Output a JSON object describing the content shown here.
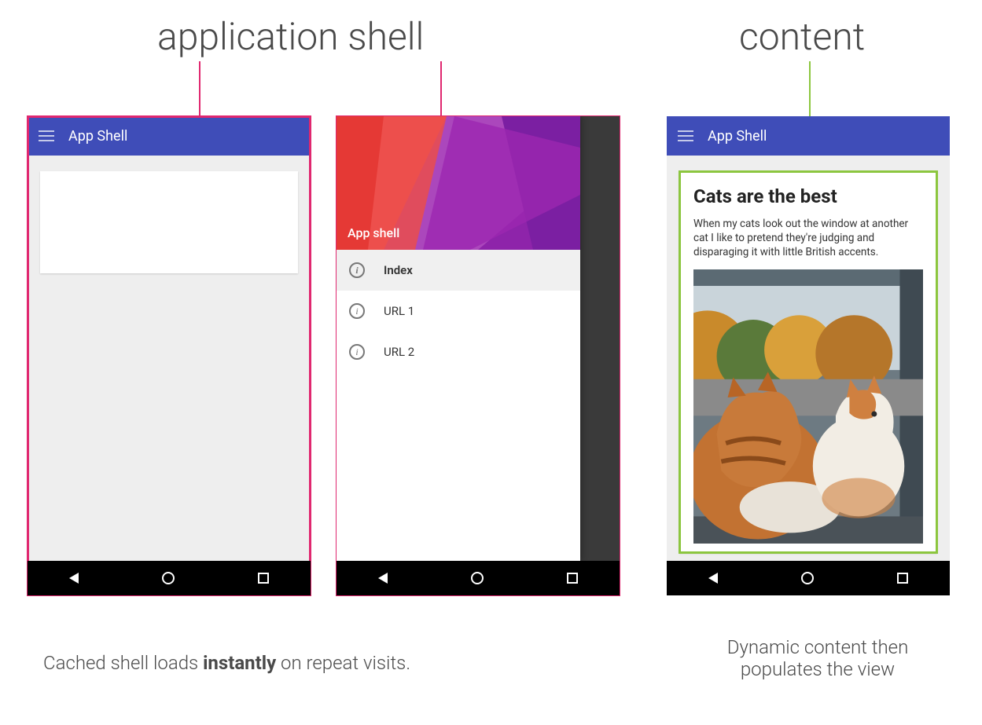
{
  "headings": {
    "left": "application shell",
    "right": "content"
  },
  "colors": {
    "shell_outline": "#e0276f",
    "content_outline": "#8cc63f",
    "appbar": "#3f4db8"
  },
  "phone1": {
    "appbar_title": "App Shell"
  },
  "phone2": {
    "drawer_header_title": "App shell",
    "items": [
      {
        "label": "Index",
        "active": true
      },
      {
        "label": "URL 1",
        "active": false
      },
      {
        "label": "URL 2",
        "active": false
      }
    ]
  },
  "phone3": {
    "appbar_title": "App Shell",
    "article_title": "Cats are the best",
    "article_body": "When my cats look out the window at another cat I like to pretend they're judging and disparaging it with little British accents."
  },
  "captions": {
    "left_pre": "Cached shell loads ",
    "left_strong": "instantly",
    "left_post": " on repeat visits.",
    "right": "Dynamic content then populates the view"
  }
}
